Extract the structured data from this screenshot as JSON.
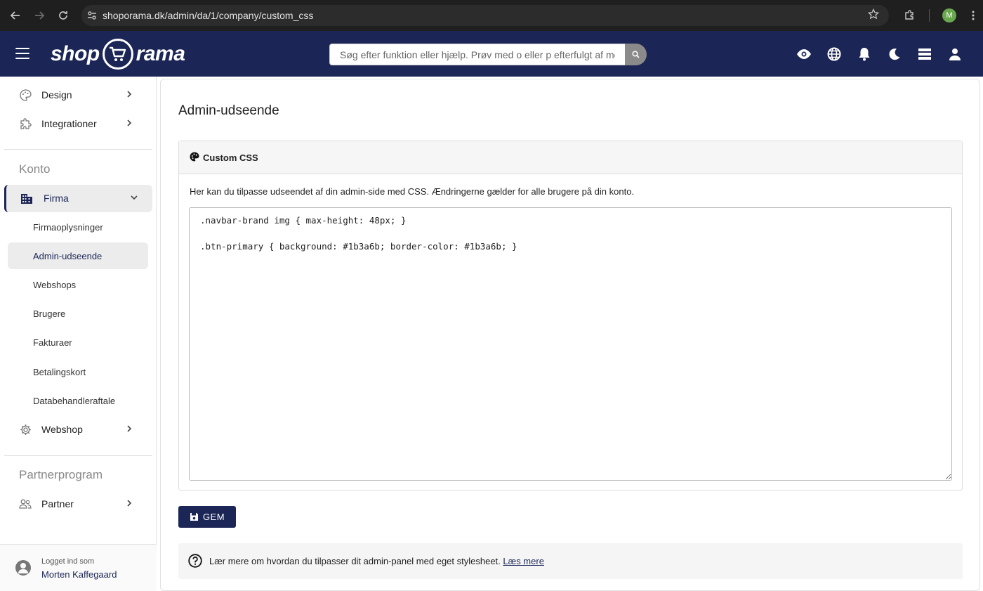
{
  "browser": {
    "url": "shoporama.dk/admin/da/1/company/custom_css",
    "profile_initial": "M"
  },
  "header": {
    "logo_left": "shop",
    "logo_right": "rama",
    "search_placeholder": "Søg efter funktion eller hjælp. Prøv med o eller p efterfulgt af me"
  },
  "sidebar": {
    "top_items": [
      {
        "label": "Design",
        "icon": "palette-icon"
      },
      {
        "label": "Integrationer",
        "icon": "puzzle-icon"
      }
    ],
    "section_konto": "Konto",
    "firma_label": "Firma",
    "sub_items": [
      "Firmaoplysninger",
      "Admin-udseende",
      "Webshops",
      "Brugere",
      "Fakturaer",
      "Betalingskort",
      "Databehandleraftale"
    ],
    "active_sub": "Admin-udseende",
    "webshop_label": "Webshop",
    "section_partner": "Partnerprogram",
    "partner_label": "Partner",
    "user": {
      "logged_in_as": "Logget ind som",
      "name": "Morten Kaffegaard"
    }
  },
  "main": {
    "title": "Admin-udseende",
    "card_title": "Custom CSS",
    "description": "Her kan du tilpasse udseendet af din admin-side med CSS. Ændringerne gælder for alle brugere på din konto.",
    "css_value": ".navbar-brand img { max-height: 48px; }\n\n.btn-primary { background: #1b3a6b; border-color: #1b3a6b; }",
    "save_label": "GEM",
    "info_text": "Lær mere om hvordan du tilpasser dit admin-panel med eget stylesheet.",
    "info_link": "Læs mere"
  },
  "colors": {
    "brand_navy": "#1b2556",
    "chrome_dark": "#1f1f1f"
  }
}
